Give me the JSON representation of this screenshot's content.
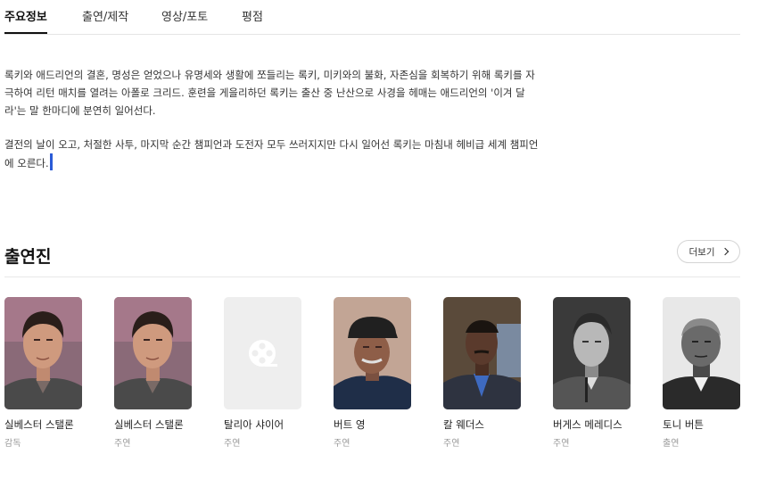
{
  "tabs": [
    {
      "label": "주요정보",
      "active": true
    },
    {
      "label": "출연/제작",
      "active": false
    },
    {
      "label": "영상/포토",
      "active": false
    },
    {
      "label": "평점",
      "active": false
    }
  ],
  "synopsis": {
    "paragraph1": "록키와 애드리언의 결혼, 명성은 얻었으나 유명세와 생활에 쪼들리는 록키, 미키와의 불화, 자존심을 회복하기 위해 록키를 자극하여 리턴 매치를 열려는 아폴로 크리드. 훈련을 게을리하던 록키는 출산 중 난산으로 사경을 헤매는 애드리언의 '이겨 달라'는 말 한마디에 분연히 일어선다.",
    "paragraph2": "결전의 날이 오고, 처절한 사투, 마지막 순간 챔피언과 도전자 모두 쓰러지지만 다시 일어선 록키는 마침내 헤비급 세계 챔피언에 오른다."
  },
  "cast": {
    "title": "출연진",
    "more_label": "더보기",
    "members": [
      {
        "name": "실베스터 스탤론",
        "role": "감독",
        "photo": "portrait"
      },
      {
        "name": "실베스터 스탤론",
        "role": "주연",
        "photo": "portrait"
      },
      {
        "name": "탈리아 샤이어",
        "role": "주연",
        "photo": "placeholder"
      },
      {
        "name": "버트 영",
        "role": "주연",
        "photo": "portrait"
      },
      {
        "name": "칼 웨더스",
        "role": "주연",
        "photo": "portrait"
      },
      {
        "name": "버게스 메레디스",
        "role": "주연",
        "photo": "portrait"
      },
      {
        "name": "토니 버튼",
        "role": "출연",
        "photo": "portrait"
      }
    ]
  },
  "colors": {
    "accent_cursor": "#2a5bd7",
    "placeholder_bg": "#eeeeee"
  }
}
